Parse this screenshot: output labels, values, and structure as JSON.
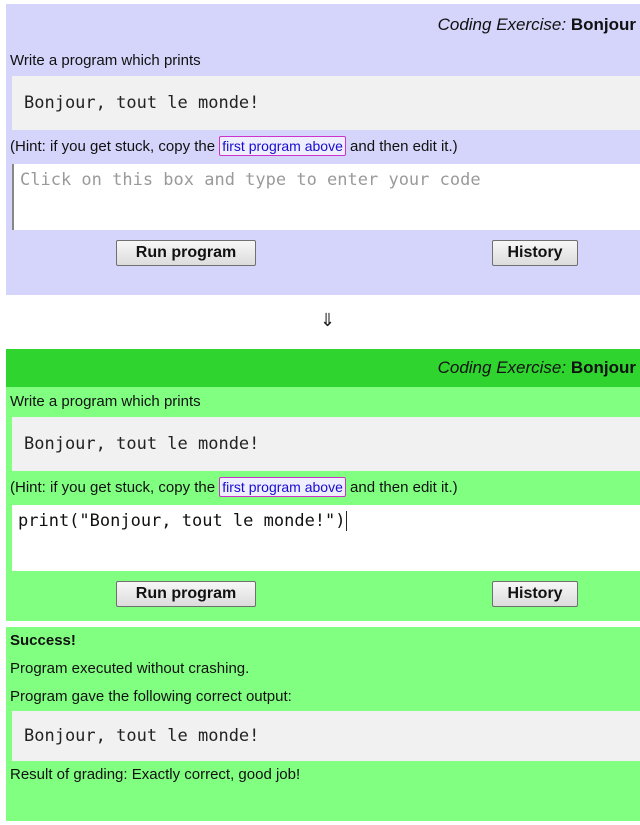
{
  "before": {
    "header_prefix": "Coding Exercise:",
    "header_title": "Bonjour",
    "instruction": "Write a program which prints",
    "expected_output": "Bonjour, tout le monde!",
    "hint_before": "(Hint: if you get stuck, copy the",
    "hint_link": "first program above",
    "hint_after": "and then edit it.)",
    "editor_placeholder": "Click on this box and type to enter your code",
    "run_label": "Run program",
    "history_label": "History"
  },
  "arrow": "⇓",
  "after": {
    "header_prefix": "Coding Exercise:",
    "header_title": "Bonjour",
    "instruction": "Write a program which prints",
    "expected_output": "Bonjour, tout le monde!",
    "hint_before": "(Hint: if you get stuck, copy the",
    "hint_link": "first program above",
    "hint_after": "and then edit it.)",
    "editor_code": "print(\"Bonjour, tout le monde!\")",
    "run_label": "Run program",
    "history_label": "History",
    "result": {
      "status": "Success!",
      "line1": "Program executed without crashing.",
      "line2": "Program gave the following correct output:",
      "output": "Bonjour, tout le monde!",
      "grading": "Result of grading: Exactly correct, good job!"
    }
  },
  "colors": {
    "before_panel": "#d5d5fb",
    "after_panel": "#80ff80",
    "after_header": "#2fd42f",
    "code_box": "#f1f1f1"
  }
}
